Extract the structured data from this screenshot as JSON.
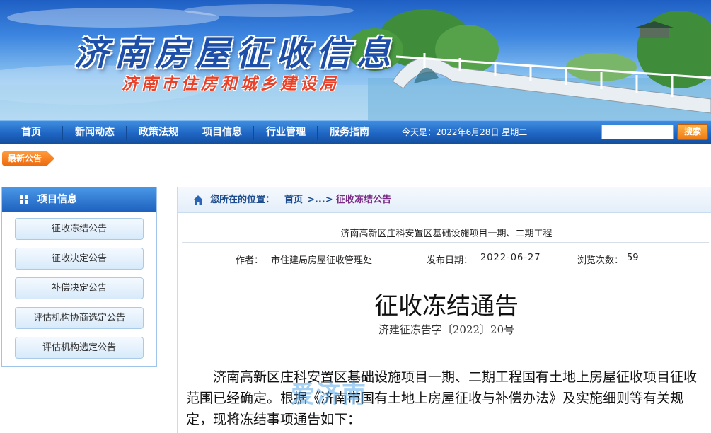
{
  "header": {
    "site_title": "济南房屋征收信息",
    "site_subtitle": "济南市住房和城乡建设局"
  },
  "nav": {
    "items": [
      "首页",
      "新闻动态",
      "政策法规",
      "项目信息",
      "行业管理",
      "服务指南"
    ],
    "date_text": "今天是：2022年6月28日 星期二",
    "search_placeholder": "",
    "search_label": "搜索"
  },
  "latest_tag": "最新公告",
  "sidebar": {
    "title": "项目信息",
    "items": [
      "征收冻结公告",
      "征收决定公告",
      "补偿决定公告",
      "评估机构协商选定公告",
      "评估机构选定公告"
    ]
  },
  "breadcrumb": {
    "label": "您所在的位置：",
    "home": "首页",
    "separator": ">...>",
    "current": "征收冻结公告"
  },
  "article": {
    "title": "济南高新区庄科安置区基础设施项目一期、二期工程",
    "author_label": "作者：",
    "author": "市住建局房屋征收管理处",
    "date_label": "发布日期：",
    "date": "2022-06-27",
    "views_label": "浏览次数：",
    "views": "59",
    "notice_title": "征收冻结通告",
    "notice_number": "济建征冻告字〔2022〕20号",
    "body": "济南高新区庄科安置区基础设施项目一期、二期工程国有土地上房屋征收项目征收范围已经确定。根据《济南市国有土地上房屋征收与补偿办法》及实施细则等有关规定，现将冻结事项通告如下："
  },
  "watermark": "爱济南",
  "colors": {
    "nav_blue": "#1f66c4",
    "accent_orange": "#f07b12",
    "title_blue": "#1d4fa8",
    "subtitle_red": "#e8432a",
    "crumb_current": "#7a2b86"
  }
}
